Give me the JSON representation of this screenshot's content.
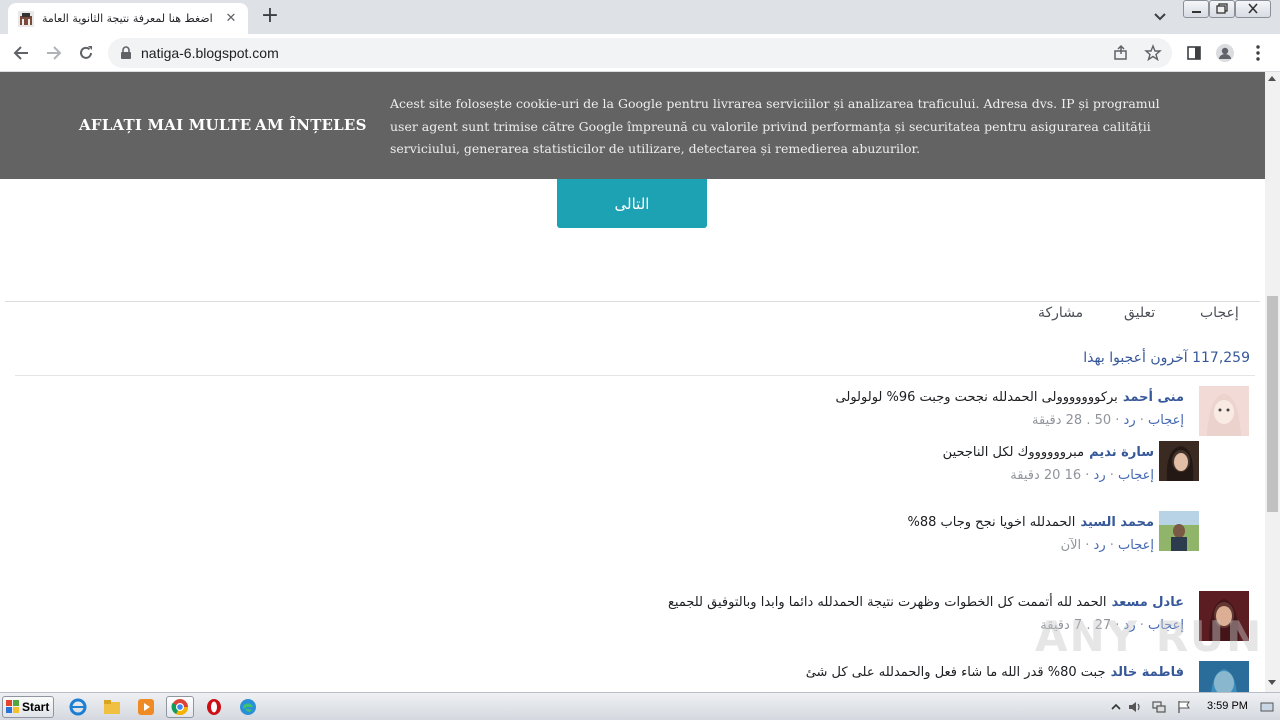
{
  "browser": {
    "tab_title": "اضغط هنا لمعرفة نتيجة الثانوية العامة",
    "tab_close": "✕",
    "new_tab": "+",
    "url": "natiga-6.blogspot.com"
  },
  "cookie_banner": {
    "learn_more": "AFLAȚI MAI MULTE",
    "accept": "AM ÎNȚELES",
    "text": "Acest site folosește cookie-uri de la Google pentru livrarea serviciilor și analizarea traficului. Adresa dvs. IP și programul user agent sunt trimise către Google împreună cu valorile privind performanța și securitatea pentru asigurarea calității serviciului, generarea statisticilor de utilizare, detectarea și remedierea abuzurilor."
  },
  "next_button": "التالى",
  "fb_actions": {
    "like": "إعجاب",
    "comment": "تعليق",
    "share": "مشاركة"
  },
  "likes": {
    "count": "117,259",
    "label": "آخرون أعجبوا بهذا"
  },
  "comments": [
    {
      "name": "منى أحمد",
      "text": "بركووووووولى الحمدلله نجحت وجبت 96% لولولولى",
      "like": "إعجاب",
      "reply": "رد",
      "likes": "50",
      "time": "28 دقيقة"
    },
    {
      "name": "سارة نديم",
      "text": "مبرووووووك لكل الناجحين",
      "like": "إعجاب",
      "reply": "رد",
      "likes": "16",
      "time": "20 دقيقة"
    },
    {
      "name": "محمد السيد",
      "text": "الحمدلله اخويا نجح وجاب 88%",
      "like": "إعجاب",
      "reply": "رد",
      "likes": "",
      "time": "الآن"
    },
    {
      "name": "عادل مسعد",
      "text": "الحمد لله أتممت كل الخطوات وظهرت نتيجة الحمدلله دائما وابدا وبالتوفيق للجميع",
      "like": "إعجاب",
      "reply": "رد",
      "likes": "27",
      "time": "7 دقيقة"
    },
    {
      "name": "فاطمة خالد",
      "text": "جبت 80% قدر الله ما شاء فعل والحمدلله على كل شئ",
      "like": "",
      "reply": "",
      "likes": "",
      "time": ""
    }
  ],
  "watermark": "ANY RUN",
  "taskbar": {
    "start": "Start",
    "clock": "3:59 PM"
  }
}
